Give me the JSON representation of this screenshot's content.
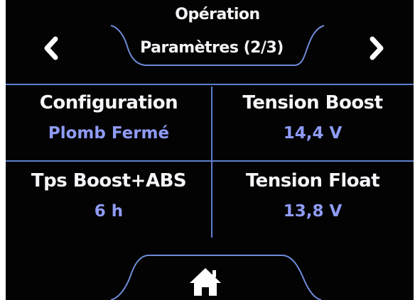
{
  "header": {
    "title": "Opération",
    "subtitle": "Paramètres (2/3)"
  },
  "nav": {
    "prev_icon": "chevron-left-icon",
    "next_icon": "chevron-right-icon"
  },
  "cells": [
    {
      "label": "Configuration",
      "value": "Plomb Fermé"
    },
    {
      "label": "Tension Boost",
      "value": "14,4 V"
    },
    {
      "label": "Tps Boost+ABS",
      "value": "6 h"
    },
    {
      "label": "Tension Float",
      "value": "13,8 V"
    }
  ],
  "footer": {
    "home_icon": "home-icon"
  },
  "colors": {
    "background": "#030303",
    "text": "#f6f6fa",
    "value": "#8f9cf5",
    "lines": "#5f7fcf"
  }
}
